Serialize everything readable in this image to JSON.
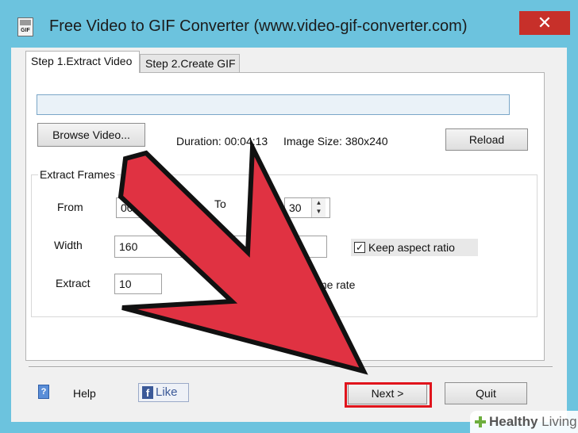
{
  "window": {
    "title": "Free Video to GIF Converter (www.video-gif-converter.com)",
    "app_icon_text": "GIF",
    "close_glyph": "✕"
  },
  "tabs": [
    {
      "label": "Step 1.Extract Video",
      "active": true
    },
    {
      "label": "Step 2.Create GIF",
      "active": false
    }
  ],
  "video": {
    "path_value": "",
    "browse_label": "Browse Video...",
    "duration": "Duration: 00:04:13",
    "image_size": "Image Size: 380x240",
    "reload_label": "Reload"
  },
  "extract_frames": {
    "group_title": "Extract Frames",
    "from_label": "From",
    "from_value": "00",
    "to_label": "To",
    "to_value": "30",
    "width_label": "Width",
    "width_value": "160",
    "keep_aspect_label": "Keep aspect ratio",
    "keep_aspect_checked": true,
    "extract_label": "Extract",
    "extract_value": "10",
    "frame_rate_label": "me rate"
  },
  "footer": {
    "help_label": "Help",
    "help_icon_glyph": "?",
    "like_label": "Like",
    "like_icon_glyph": "f",
    "next_label": "Next >",
    "quit_label": "Quit"
  },
  "watermark": {
    "brand_bold": "Healthy",
    "brand_light": " Living"
  },
  "colors": {
    "window_frame": "#6cc3de",
    "close_button": "#c7302a",
    "arrow_fill": "#e03242",
    "highlight_border": "#e0141c"
  },
  "icons": {
    "app": "gif-app-icon",
    "close": "close-icon",
    "help": "help-book-icon",
    "like": "facebook-icon",
    "arrow": "red-pointer-arrow-icon",
    "checkbox": "checkmark-icon"
  }
}
